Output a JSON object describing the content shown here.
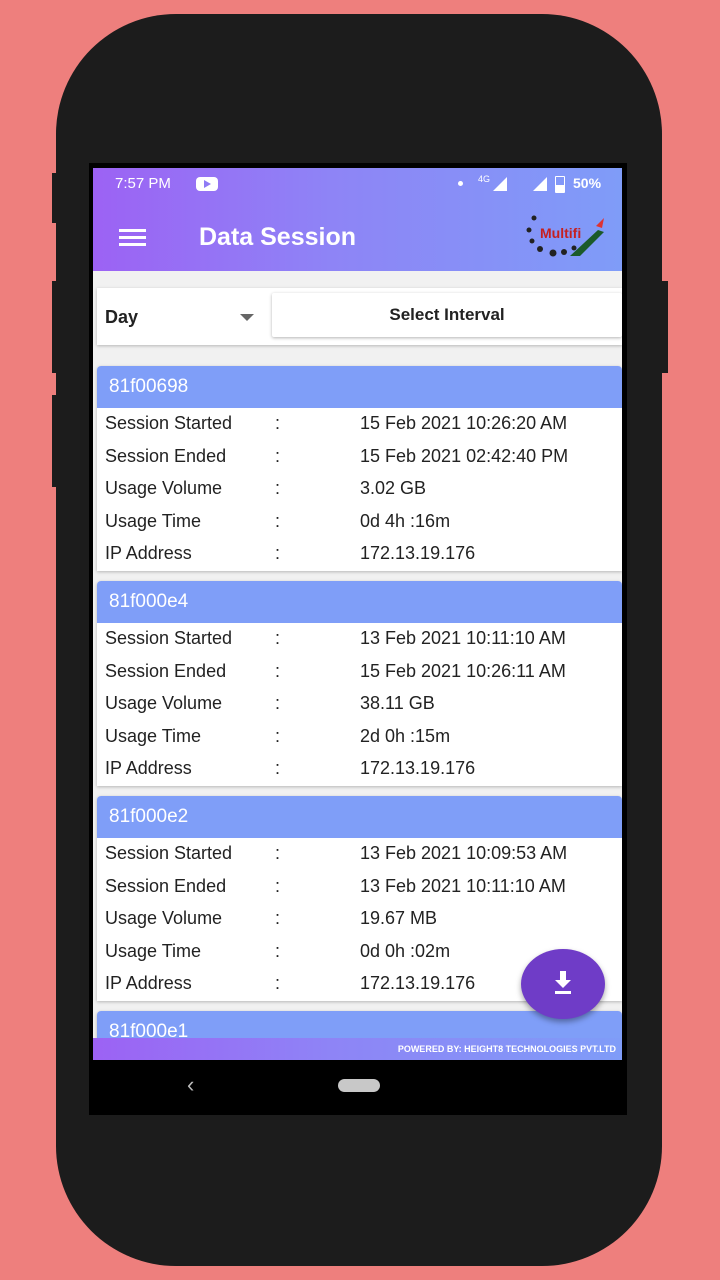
{
  "status_bar": {
    "time": "7:57 PM",
    "network": "4G",
    "battery": "50%"
  },
  "header": {
    "title": "Data Session",
    "logo_text": "Multifi"
  },
  "filter": {
    "period": "Day",
    "interval_button": "Select Interval"
  },
  "field_labels": {
    "started": "Session Started",
    "ended": "Session Ended",
    "volume": "Usage Volume",
    "time": "Usage Time",
    "ip": "IP Address",
    "separator": ":"
  },
  "sessions": [
    {
      "id": "81f00698",
      "started": "15 Feb 2021 10:26:20 AM",
      "ended": "15 Feb 2021 02:42:40 PM",
      "volume": "3.02 GB",
      "time": "0d 4h :16m",
      "ip": "172.13.19.176"
    },
    {
      "id": "81f000e4",
      "started": "13 Feb 2021 10:11:10 AM",
      "ended": "15 Feb 2021 10:26:11 AM",
      "volume": "38.11 GB",
      "time": "2d 0h :15m",
      "ip": "172.13.19.176"
    },
    {
      "id": "81f000e2",
      "started": "13 Feb 2021 10:09:53 AM",
      "ended": "13 Feb 2021 10:11:10 AM",
      "volume": "19.67 MB",
      "time": "0d 0h :02m",
      "ip": "172.13.19.176"
    },
    {
      "id": "81f000e1"
    }
  ],
  "fab": {
    "icon": "download-icon"
  },
  "footer": {
    "text": "POWERED BY: HEIGHT8 TECHNOLOGIES PVT.LTD"
  },
  "colors": {
    "header_start": "#9c62f4",
    "header_end": "#7f9cf8",
    "card_header": "#7f9ef8",
    "fab": "#6f3cc7",
    "background": "#ee7f7d"
  }
}
